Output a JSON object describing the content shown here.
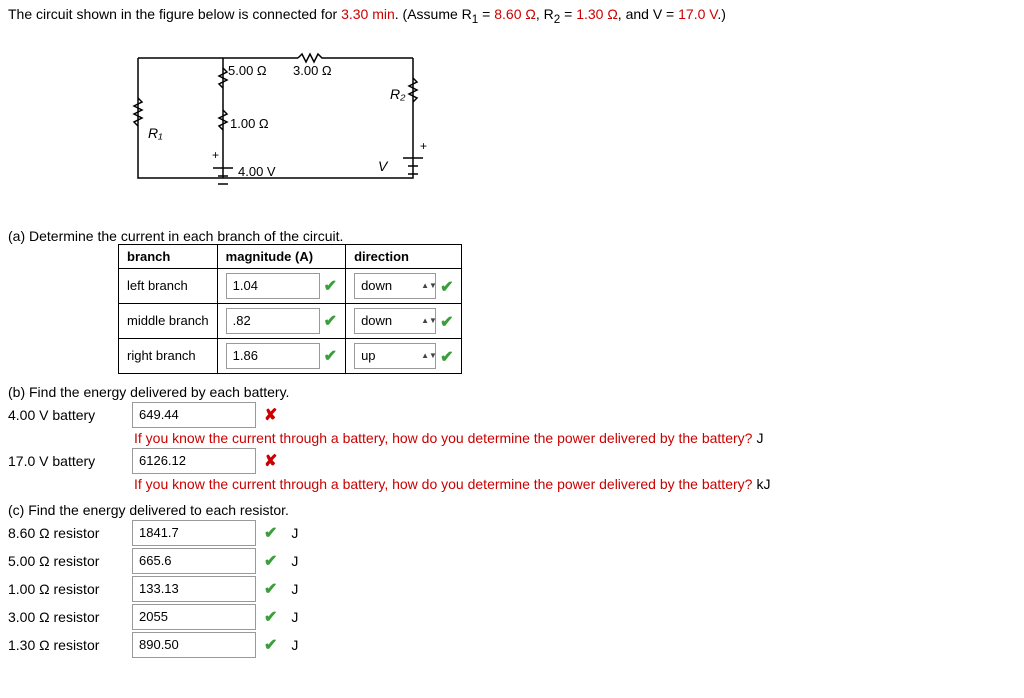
{
  "problem": {
    "prefix": "The circuit shown in the figure below is connected for ",
    "time": "3.30 min",
    "mid1": ". (Assume R",
    "sub1": "1",
    "mid2": " = ",
    "r1": "8.60 Ω",
    "mid3": ", R",
    "sub2": "2",
    "mid4": " = ",
    "r2": "1.30 Ω",
    "mid5": ", and V = ",
    "v": "17.0 V",
    "suffix": ".)"
  },
  "circuit": {
    "r_5": "5.00 Ω",
    "r_3": "3.00 Ω",
    "r_1": "1.00 Ω",
    "r1_label": "R₁",
    "r2_label": "R₂",
    "v4": "4.00 V",
    "vlabel": "V",
    "plus": "+"
  },
  "partA": {
    "prompt": "(a) Determine the current in each branch of the circuit.",
    "headers": {
      "branch": "branch",
      "mag": "magnitude (A)",
      "dir": "direction"
    },
    "rows": [
      {
        "branch": "left branch",
        "mag": "1.04",
        "dir": "down"
      },
      {
        "branch": "middle branch",
        "mag": ".82",
        "dir": "down"
      },
      {
        "branch": "right branch",
        "mag": "1.86",
        "dir": "up"
      }
    ]
  },
  "partB": {
    "prompt": "(b) Find the energy delivered by each battery.",
    "rows": [
      {
        "label": "4.00 V battery",
        "val": "649.44",
        "unit": "J",
        "hint": "If you know the current through a battery, how do you determine the power delivered by the battery?"
      },
      {
        "label": "17.0 V battery",
        "val": "6126.12",
        "unit": "kJ",
        "hint": "If you know the current through a battery, how do you determine the power delivered by the battery?"
      }
    ]
  },
  "partC": {
    "prompt": "(c) Find the energy delivered to each resistor.",
    "rows": [
      {
        "label": "8.60 Ω resistor",
        "val": "1841.7",
        "unit": "J"
      },
      {
        "label": "5.00 Ω resistor",
        "val": "665.6",
        "unit": "J"
      },
      {
        "label": "1.00 Ω resistor",
        "val": "133.13",
        "unit": "J"
      },
      {
        "label": "3.00 Ω resistor",
        "val": "2055",
        "unit": "J"
      },
      {
        "label": "1.30 Ω resistor",
        "val": "890.50",
        "unit": "J"
      }
    ]
  }
}
